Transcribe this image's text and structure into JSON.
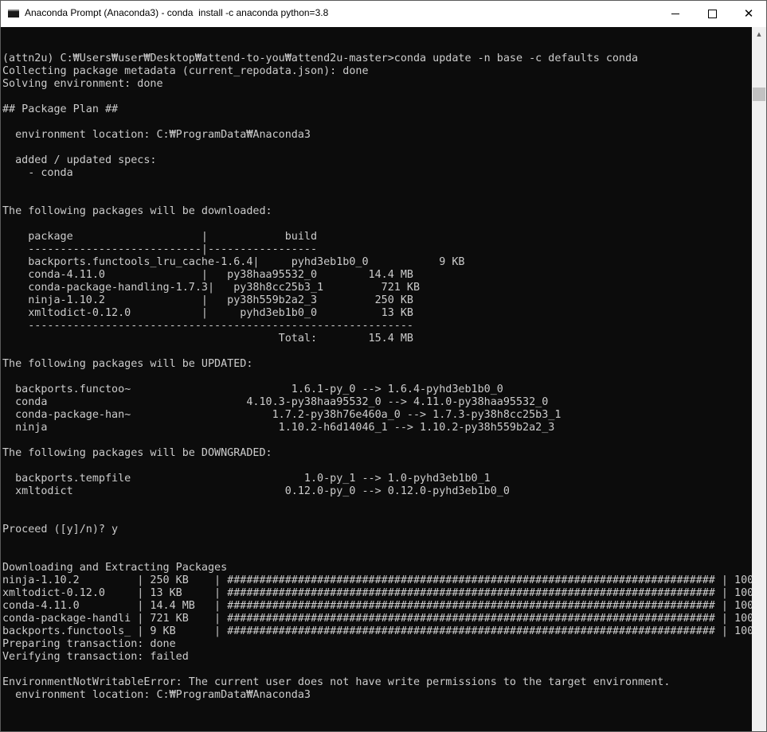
{
  "window": {
    "title": "Anaconda Prompt (Anaconda3) - conda  install -c anaconda python=3.8",
    "icon": "terminal-icon",
    "controls": {
      "minimize": "minimize-icon",
      "maximize": "maximize-icon",
      "close": "✕"
    }
  },
  "console": {
    "text": "(attn2u) C:₩Users₩user₩Desktop₩attend-to-you₩attend2u-master>conda update -n base -c defaults conda\nCollecting package metadata (current_repodata.json): done\nSolving environment: done\n\n## Package Plan ##\n\n  environment location: C:₩ProgramData₩Anaconda3\n\n  added / updated specs:\n    - conda\n\n\nThe following packages will be downloaded:\n\n    package                    |            build\n    ---------------------------|-----------------\n    backports.functools_lru_cache-1.6.4|     pyhd3eb1b0_0           9 KB\n    conda-4.11.0               |   py38haa95532_0        14.4 MB\n    conda-package-handling-1.7.3|   py38h8cc25b3_1         721 KB\n    ninja-1.10.2               |   py38h559b2a2_3         250 KB\n    xmltodict-0.12.0           |     pyhd3eb1b0_0          13 KB\n    ------------------------------------------------------------\n                                           Total:        15.4 MB\n\nThe following packages will be UPDATED:\n\n  backports.functoo~                         1.6.1-py_0 --> 1.6.4-pyhd3eb1b0_0\n  conda                               4.10.3-py38haa95532_0 --> 4.11.0-py38haa95532_0\n  conda-package-han~                      1.7.2-py38h76e460a_0 --> 1.7.3-py38h8cc25b3_1\n  ninja                                    1.10.2-h6d14046_1 --> 1.10.2-py38h559b2a2_3\n\nThe following packages will be DOWNGRADED:\n\n  backports.tempfile                           1.0-py_1 --> 1.0-pyhd3eb1b0_1\n  xmltodict                                 0.12.0-py_0 --> 0.12.0-pyhd3eb1b0_0\n\n\nProceed ([y]/n)? y\n\n\nDownloading and Extracting Packages\nninja-1.10.2         | 250 KB    | ############################################################################ | 100%\nxmltodict-0.12.0     | 13 KB     | ############################################################################ | 100%\nconda-4.11.0         | 14.4 MB   | ############################################################################ | 100%\nconda-package-handli | 721 KB    | ############################################################################ | 100%\nbackports.functools_ | 9 KB      | ############################################################################ | 100%\nPreparing transaction: done\nVerifying transaction: failed\n\nEnvironmentNotWritableError: The current user does not have write permissions to the target environment.\n  environment location: C:₩ProgramData₩Anaconda3"
  },
  "scrollbar": {
    "up_arrow": "▲"
  },
  "colors": {
    "console_bg": "#0c0c0c",
    "console_fg": "#cccccc",
    "titlebar_bg": "#ffffff",
    "scrollbar_bg": "#f0f0f0",
    "scroll_thumb": "#c2c2c2"
  }
}
